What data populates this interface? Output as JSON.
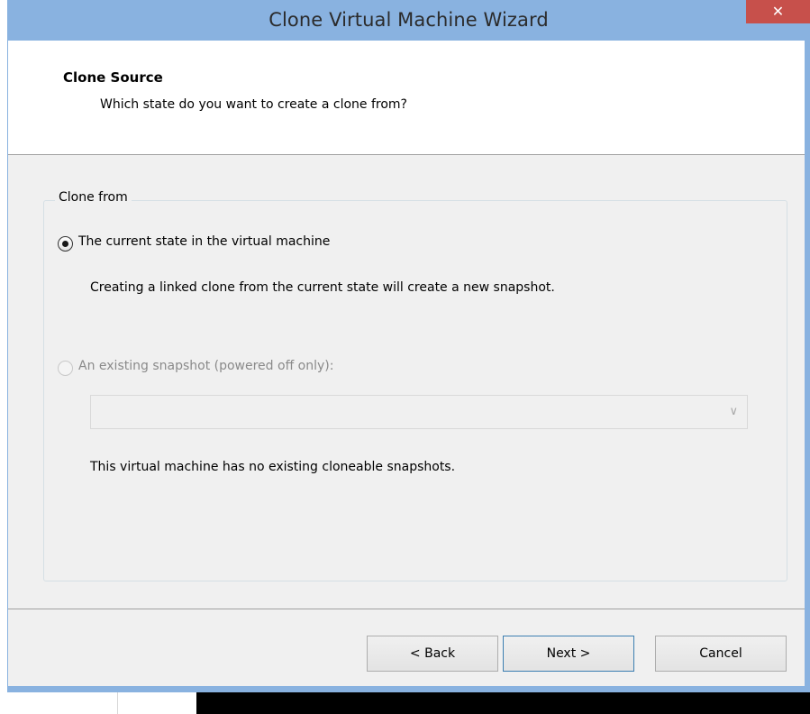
{
  "window": {
    "title": "Clone Virtual Machine Wizard",
    "close_symbol": "✕"
  },
  "header": {
    "title": "Clone Source",
    "subtitle": "Which state do you want to create a clone from?"
  },
  "clone_from": {
    "label": "Clone from",
    "option_current": {
      "label": "The current state in the virtual machine",
      "selected": true,
      "enabled": true,
      "description": "Creating a linked clone from the current state will create a new snapshot."
    },
    "option_snapshot": {
      "label": "An existing snapshot (powered off only):",
      "selected": false,
      "enabled": false
    },
    "snapshot_select": {
      "value": "",
      "arrow": "∨"
    },
    "snapshot_note": "This virtual machine has no existing cloneable snapshots."
  },
  "buttons": {
    "back": "< Back",
    "next": "Next >",
    "cancel": "Cancel"
  },
  "colors": {
    "titlebar": "#89b2e0",
    "close_button": "#c7504b",
    "dialog_bg": "#f0f0f0",
    "header_bg": "#ffffff",
    "default_button_border": "#3c7fb1"
  },
  "icons": {
    "close": "close-icon",
    "dropdown": "chevron-down-icon"
  }
}
